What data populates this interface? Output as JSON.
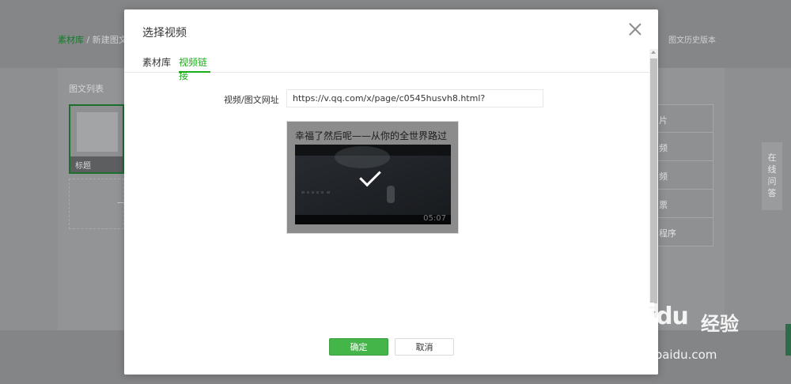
{
  "background": {
    "breadcrumb": {
      "home": "素材库",
      "separator": "/",
      "current": "新建图文"
    },
    "history_label": "图文历史版本",
    "list_title": "图文列表",
    "card_title": "标题",
    "add_label": "—",
    "menu_items": [
      "片",
      "频",
      "频",
      "票",
      "程序"
    ],
    "side_help": [
      "在",
      "线",
      "问",
      "答"
    ]
  },
  "dialog": {
    "title": "选择视频",
    "tabs": [
      {
        "label": "素材库",
        "active": false
      },
      {
        "label": "视频链接",
        "active": true
      }
    ],
    "url_label": "视频/图文网址",
    "url_value": "https://v.qq.com/x/page/c0545husvh8.html?",
    "video": {
      "title": "幸福了然后呢——从你的全世界路过",
      "duration": "05:07",
      "selected": true
    },
    "buttons": {
      "ok": "确定",
      "cancel": "取消"
    }
  },
  "watermark": {
    "brand": "Bai",
    "brand2": "du",
    "cn": "经验",
    "url": "jingyan.baidu.com"
  },
  "colors": {
    "accent": "#1aad19",
    "ok_button": "#44b549"
  }
}
